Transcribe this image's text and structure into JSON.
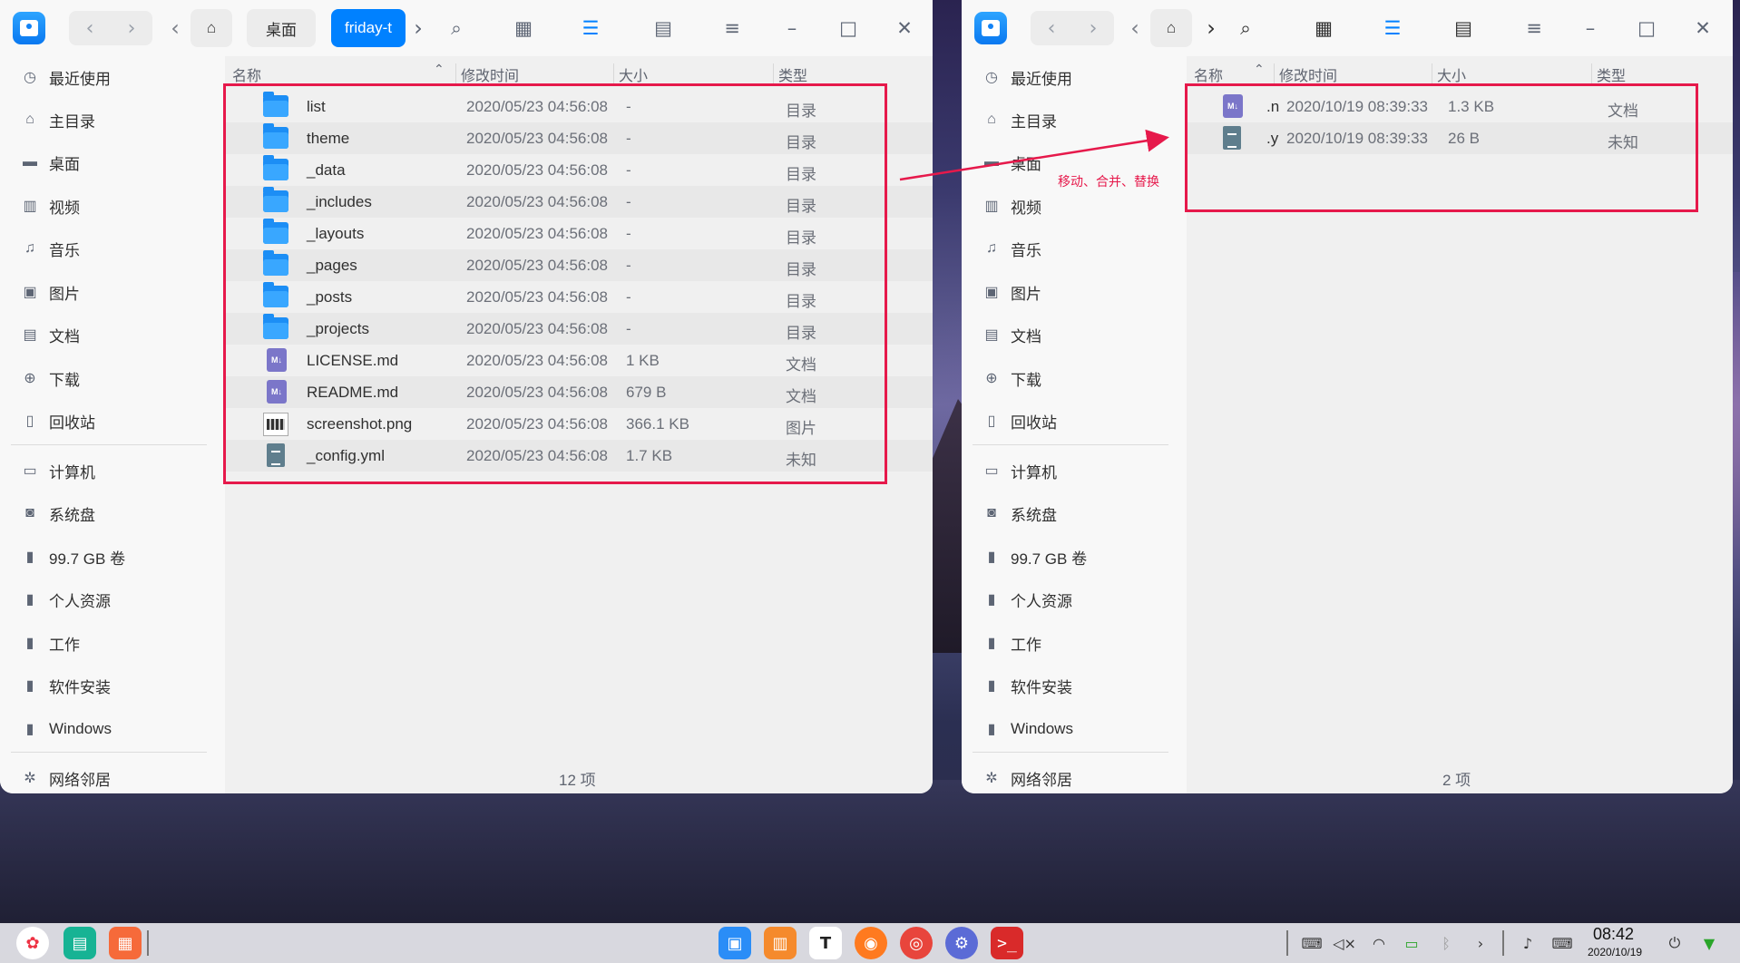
{
  "sidebar_items": [
    {
      "label": "最近使用",
      "icon": "clock-icon"
    },
    {
      "label": "主目录",
      "icon": "home-icon"
    },
    {
      "label": "桌面",
      "icon": "desktop-icon"
    },
    {
      "label": "视频",
      "icon": "video-icon"
    },
    {
      "label": "音乐",
      "icon": "music-icon"
    },
    {
      "label": "图片",
      "icon": "picture-icon"
    },
    {
      "label": "文档",
      "icon": "document-icon"
    },
    {
      "label": "下载",
      "icon": "download-icon"
    },
    {
      "label": "回收站",
      "icon": "trash-icon"
    },
    {
      "label": "计算机",
      "icon": "computer-icon"
    },
    {
      "label": "系统盘",
      "icon": "system-disk-icon"
    },
    {
      "label": "99.7 GB 卷",
      "icon": "drive-icon"
    },
    {
      "label": "个人资源",
      "icon": "drive-icon"
    },
    {
      "label": "工作",
      "icon": "drive-icon"
    },
    {
      "label": "软件安装",
      "icon": "drive-icon"
    },
    {
      "label": "Windows",
      "icon": "drive-icon"
    },
    {
      "label": "网络邻居",
      "icon": "network-icon"
    }
  ],
  "columns": {
    "name": "名称",
    "modified": "修改时间",
    "size": "大小",
    "type": "类型"
  },
  "left_window": {
    "breadcrumb": {
      "home_label": "桌面",
      "current_label": "friday-t"
    },
    "files": [
      {
        "name": "list",
        "modified": "2020/05/23 04:56:08",
        "size": "-",
        "type": "目录",
        "icon": "folder-icon"
      },
      {
        "name": "theme",
        "modified": "2020/05/23 04:56:08",
        "size": "-",
        "type": "目录",
        "icon": "folder-icon"
      },
      {
        "name": "_data",
        "modified": "2020/05/23 04:56:08",
        "size": "-",
        "type": "目录",
        "icon": "folder-icon"
      },
      {
        "name": "_includes",
        "modified": "2020/05/23 04:56:08",
        "size": "-",
        "type": "目录",
        "icon": "folder-icon"
      },
      {
        "name": "_layouts",
        "modified": "2020/05/23 04:56:08",
        "size": "-",
        "type": "目录",
        "icon": "folder-icon"
      },
      {
        "name": "_pages",
        "modified": "2020/05/23 04:56:08",
        "size": "-",
        "type": "目录",
        "icon": "folder-icon"
      },
      {
        "name": "_posts",
        "modified": "2020/05/23 04:56:08",
        "size": "-",
        "type": "目录",
        "icon": "folder-icon"
      },
      {
        "name": "_projects",
        "modified": "2020/05/23 04:56:08",
        "size": "-",
        "type": "目录",
        "icon": "folder-icon"
      },
      {
        "name": "LICENSE.md",
        "modified": "2020/05/23 04:56:08",
        "size": "1 KB",
        "type": "文档",
        "icon": "markdown-file-icon"
      },
      {
        "name": "README.md",
        "modified": "2020/05/23 04:56:08",
        "size": "679 B",
        "type": "文档",
        "icon": "markdown-file-icon"
      },
      {
        "name": "screenshot.png",
        "modified": "2020/05/23 04:56:08",
        "size": "366.1 KB",
        "type": "图片",
        "icon": "image-file-icon"
      },
      {
        "name": "_config.yml",
        "modified": "2020/05/23 04:56:08",
        "size": "1.7 KB",
        "type": "未知",
        "icon": "config-file-icon"
      }
    ],
    "item_count": "12 项"
  },
  "right_window": {
    "files": [
      {
        "name": ".n",
        "modified": "2020/10/19 08:39:33",
        "size": "1.3 KB",
        "type": "文档",
        "icon": "markdown-file-icon"
      },
      {
        "name": ".y",
        "modified": "2020/10/19 08:39:33",
        "size": "26 B",
        "type": "未知",
        "icon": "config-file-icon"
      }
    ],
    "item_count": "2 项"
  },
  "annotation": {
    "label": "移动、合并、替换",
    "color": "#e6194b"
  },
  "colors": {
    "accent": "#0081ff",
    "folder": "#1c8ef5"
  },
  "taskbar": {
    "time": "08:42",
    "date": "2020/10/19"
  }
}
